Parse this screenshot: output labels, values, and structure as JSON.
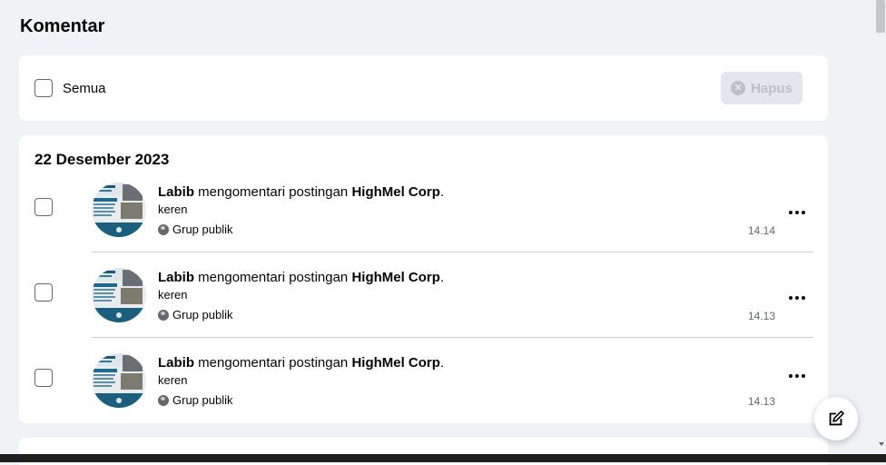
{
  "page": {
    "title": "Komentar"
  },
  "select_bar": {
    "select_all_label": "Semua",
    "delete_label": "Hapus"
  },
  "activity": {
    "date": "22 Desember 2023",
    "items": [
      {
        "actor": "Labib",
        "action": " mengomentari postingan ",
        "target": "HighMel Corp",
        "suffix": ".",
        "comment": "keren",
        "privacy": "Grup publik",
        "time": "14.14"
      },
      {
        "actor": "Labib",
        "action": " mengomentari postingan ",
        "target": "HighMel Corp",
        "suffix": ".",
        "comment": "keren",
        "privacy": "Grup publik",
        "time": "14.13"
      },
      {
        "actor": "Labib",
        "action": " mengomentari postingan ",
        "target": "HighMel Corp",
        "suffix": ".",
        "comment": "keren",
        "privacy": "Grup publik",
        "time": "14.13"
      }
    ]
  },
  "icons": {
    "globe": "globe-icon",
    "more": "more-options-icon",
    "compose": "compose-icon",
    "delete": "close-circle-icon"
  },
  "colors": {
    "background": "#f0f2f5",
    "card": "#ffffff",
    "text": "#050505",
    "muted": "#65676b",
    "disabled": "#bcc0c4"
  }
}
